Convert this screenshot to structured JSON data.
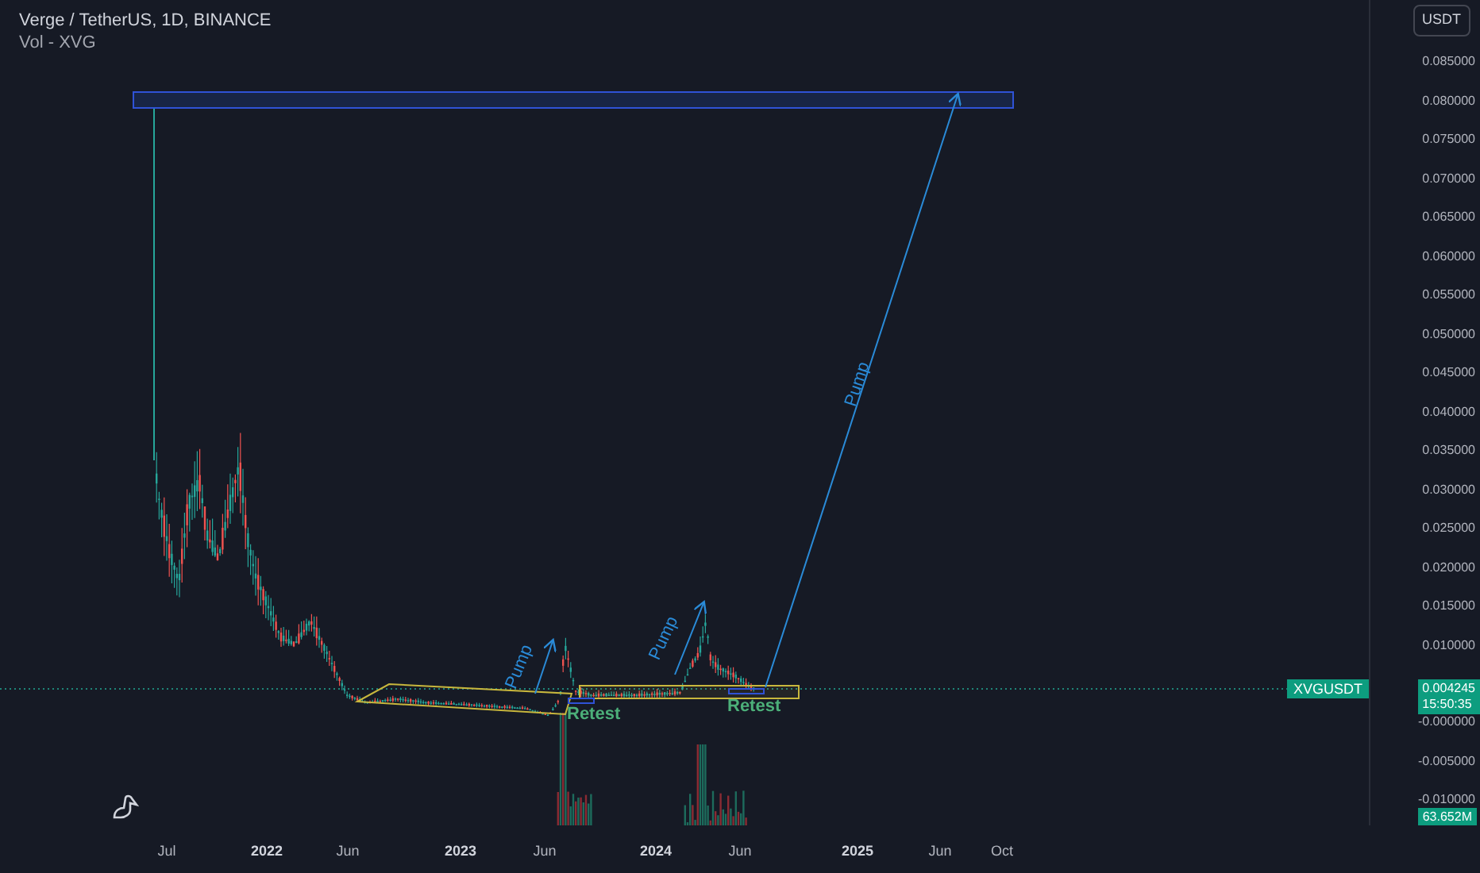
{
  "header": {
    "symbol": "Verge / TetherUS, 1D, BINANCE",
    "indicator": "Vol - XVG"
  },
  "currency_button": "USDT",
  "upper_ticks": [
    "0.085000",
    "0.080000",
    "0.075000",
    "0.070000",
    "0.065000",
    "0.060000",
    "0.055000",
    "0.050000",
    "0.045000",
    "0.040000",
    "0.035000",
    "0.030000",
    "0.025000",
    "0.020000",
    "0.015000",
    "0.010000"
  ],
  "lower_ticks": [
    "-0.000000",
    "-0.005000",
    "-0.010000"
  ],
  "time_axis": [
    {
      "label": "Jul",
      "kind": "month"
    },
    {
      "label": "2022",
      "kind": "year"
    },
    {
      "label": "Jun",
      "kind": "month"
    },
    {
      "label": "2023",
      "kind": "year"
    },
    {
      "label": "Jun",
      "kind": "month"
    },
    {
      "label": "2024",
      "kind": "year"
    },
    {
      "label": "Jun",
      "kind": "month"
    },
    {
      "label": "2025",
      "kind": "year"
    },
    {
      "label": "Jun",
      "kind": "month"
    },
    {
      "label": "Oct",
      "kind": "month"
    }
  ],
  "last_price": {
    "symbol": "XVGUSDT",
    "price": "0.004245",
    "countdown": "15:50:35"
  },
  "volume_label": "63.652M",
  "annotations": {
    "pump_labels": [
      "Pump",
      "Pump",
      "Pump"
    ],
    "retest_labels": [
      "Retest",
      "Retest"
    ]
  }
}
